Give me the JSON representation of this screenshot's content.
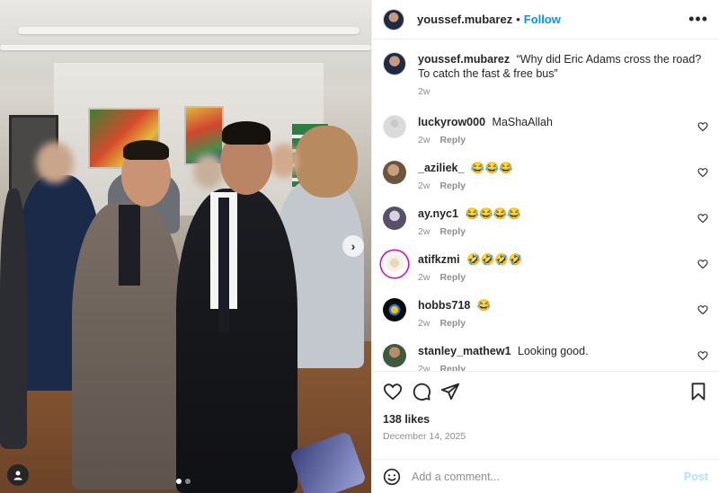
{
  "post": {
    "author": "youssef.mubarez",
    "follow_label": "Follow",
    "separator": "•",
    "more_label": "•••"
  },
  "caption": {
    "user": "youssef.mubarez",
    "text": "“Why did Eric Adams cross the road? To catch the fast & free bus”",
    "time": "2w"
  },
  "comments": [
    {
      "user": "luckyrow000",
      "text": "MaShaAllah",
      "time": "2w",
      "reply": "Reply"
    },
    {
      "user": "_aziliek_",
      "text": "😂😂😂",
      "time": "2w",
      "reply": "Reply"
    },
    {
      "user": "ay.nyc1",
      "text": "😂😂😂😂",
      "time": "2w",
      "reply": "Reply"
    },
    {
      "user": "atifkzmi",
      "text": "🤣🤣🤣🤣",
      "time": "2w",
      "reply": "Reply"
    },
    {
      "user": "hobbs718",
      "text": "😂",
      "time": "2w",
      "reply": "Reply"
    },
    {
      "user": "stanley_mathew1",
      "text": "Looking good.",
      "time": "2w",
      "reply": "Reply"
    }
  ],
  "stats": {
    "likes": "138 likes",
    "date": "December 14, 2025"
  },
  "composer": {
    "placeholder": "Add a comment...",
    "post_label": "Post"
  },
  "media": {
    "next_glyph": "›",
    "slide_count": 2,
    "current_slide": 1
  },
  "colors": {
    "link": "#0095f6",
    "post_disabled": "#b2dffc",
    "muted": "#8e8e8e",
    "text": "#262626",
    "story_ring": "#d300c5"
  },
  "icons": [
    "heart-icon",
    "comment-icon",
    "share-icon",
    "bookmark-icon",
    "emoji-icon",
    "more-icon",
    "user-tag-icon",
    "chevron-right-icon"
  ]
}
